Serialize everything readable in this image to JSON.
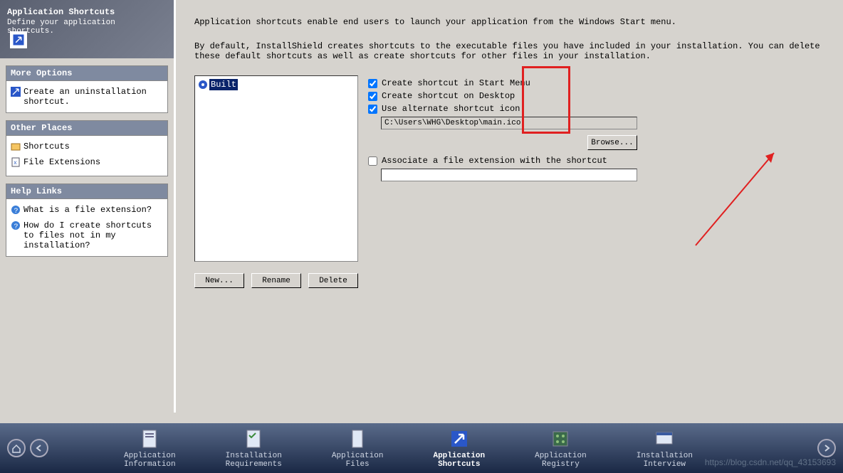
{
  "header": {
    "title": "Application Shortcuts",
    "subtitle": "Define your application shortcuts."
  },
  "sidebar": {
    "more_options": {
      "title": "More Options",
      "items": [
        {
          "label": "Create an uninstallation shortcut."
        }
      ]
    },
    "other_places": {
      "title": "Other Places",
      "items": [
        {
          "label": "Shortcuts"
        },
        {
          "label": "File Extensions"
        }
      ]
    },
    "help_links": {
      "title": "Help Links",
      "items": [
        {
          "label": "What is a file extension?"
        },
        {
          "label": "How do I create shortcuts to files not in my installation?"
        }
      ]
    }
  },
  "main": {
    "desc1": "Application shortcuts enable end users to launch your application from the Windows Start menu.",
    "desc2": "By default, InstallShield creates shortcuts to the executable files you have included in your installation. You can delete these default shortcuts as well as create shortcuts for other files in your installation.",
    "tree_item": "Built",
    "buttons": {
      "new": "New...",
      "rename": "Rename",
      "delete": "Delete"
    },
    "checks": {
      "start_menu": "Create shortcut in Start Menu",
      "desktop": "Create shortcut on Desktop",
      "alt_icon": "Use alternate shortcut icon:",
      "assoc_ext": "Associate a file extension with the shortcut"
    },
    "icon_path": "C:\\Users\\WHG\\Desktop\\main.ico",
    "ext_value": "",
    "browse": "Browse..."
  },
  "nav": {
    "items": [
      {
        "label1": "Application",
        "label2": "Information"
      },
      {
        "label1": "Installation",
        "label2": "Requirements"
      },
      {
        "label1": "Application",
        "label2": "Files"
      },
      {
        "label1": "Application",
        "label2": "Shortcuts"
      },
      {
        "label1": "Application",
        "label2": "Registry"
      },
      {
        "label1": "Installation",
        "label2": "Interview"
      }
    ]
  },
  "watermark": "https://blog.csdn.net/qq_43153693"
}
